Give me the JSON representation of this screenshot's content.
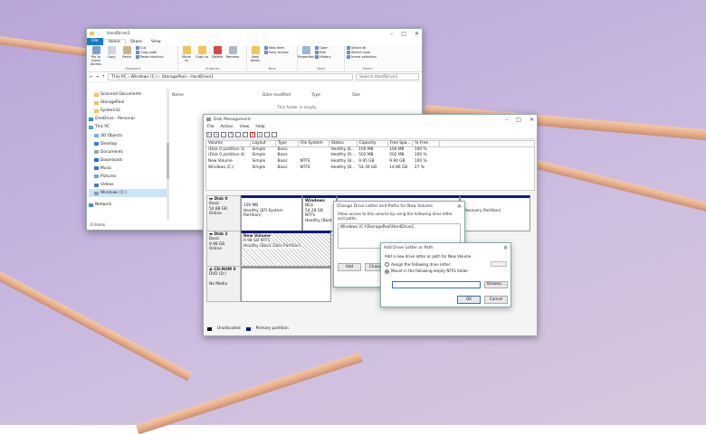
{
  "explorer": {
    "title": "HardDrive1",
    "tabs": [
      "File",
      "Home",
      "Share",
      "View"
    ],
    "ribbon": {
      "clipboard": {
        "label": "Clipboard",
        "pin": "Pin to Quick access",
        "copy": "Copy",
        "paste": "Paste",
        "cut": "Cut",
        "copy_path": "Copy path",
        "paste_shortcut": "Paste shortcut"
      },
      "organize": {
        "label": "Organize",
        "move": "Move to",
        "copy": "Copy to",
        "delete": "Delete",
        "rename": "Rename"
      },
      "new": {
        "label": "New",
        "new_folder": "New folder",
        "new_item": "New item",
        "easy_access": "Easy access"
      },
      "open": {
        "label": "Open",
        "properties": "Properties",
        "open": "Open",
        "edit": "Edit",
        "history": "History"
      },
      "select": {
        "label": "Select",
        "select_all": "Select all",
        "select_none": "Select none",
        "invert": "Invert selection"
      }
    },
    "address": {
      "path": "This PC  ›  Windows (C:)  ›  StoragePool  ›  HardDrive1",
      "search_placeholder": "Search HardDrive1"
    },
    "nav": [
      "Scanned Documents",
      "StoragePool",
      "System32",
      "OneDrive - Personal",
      "This PC",
      "3D Objects",
      "Desktop",
      "Documents",
      "Downloads",
      "Music",
      "Pictures",
      "Videos",
      "Windows (C:)",
      "Network"
    ],
    "columns": [
      "Name",
      "Date modified",
      "Type",
      "Size"
    ],
    "empty_text": "This folder is empty.",
    "status": "0 items"
  },
  "diskmgmt": {
    "title": "Disk Management",
    "menu": [
      "File",
      "Action",
      "View",
      "Help"
    ],
    "table_headers": [
      "Volume",
      "Layout",
      "Type",
      "File System",
      "Status",
      "Capacity",
      "Free Spa...",
      "% Free"
    ],
    "rows": [
      [
        "(Disk 0 partition 1)",
        "Simple",
        "Basic",
        "",
        "Healthy (E...",
        "100 MB",
        "100 MB",
        "100 %"
      ],
      [
        "(Disk 0 partition 4)",
        "Simple",
        "Basic",
        "",
        "Healthy (R...",
        "502 MB",
        "502 MB",
        "100 %"
      ],
      [
        "New Volume",
        "Simple",
        "Basic",
        "NTFS",
        "Healthy (B...",
        "9.95 GB",
        "9.90 GB",
        "100 %"
      ],
      [
        "Windows (C:)",
        "Simple",
        "Basic",
        "NTFS",
        "Healthy (B...",
        "54.39 GB",
        "14.86 GB",
        "27 %"
      ]
    ],
    "disk0": {
      "name": "Disk 0",
      "type": "Basic",
      "size": "54.88 GB",
      "state": "Online",
      "p1_size": "100 MB",
      "p1_status": "Healthy (EFI System Partition)",
      "p2_name": "Windows (C:)",
      "p2_size": "54.28 GB NTFS",
      "p2_status": "Healthy (Boot",
      "p3_status": "(Recovery Partition)"
    },
    "disk2": {
      "name": "Disk 2",
      "type": "Basic",
      "size": "9.98 GB",
      "state": "Online",
      "p_name": "New Volume",
      "p_size": "9.98 GB NTFS",
      "p_status": "Healthy (Basic Data Partition)"
    },
    "cdrom": {
      "name": "CD-ROM 0",
      "type": "DVD (D:)",
      "state": "No Media"
    },
    "legend": [
      "Unallocated",
      "Primary partition"
    ]
  },
  "change_dialog": {
    "title": "Change Drive Letter and Paths for New Volume",
    "desc": "Allow access to this volume by using the following drive letter and paths:",
    "item": "Windows (C:)\\StoragePool\\HardDrive1",
    "add": "Add",
    "change": "Change"
  },
  "add_dialog": {
    "title": "Add Drive Letter or Path",
    "desc": "Add a new drive letter or path for New Volume.",
    "opt1": "Assign the following drive letter:",
    "opt2": "Mount in the following empty NTFS folder:",
    "browse": "Browse...",
    "ok": "OK",
    "cancel": "Cancel"
  }
}
